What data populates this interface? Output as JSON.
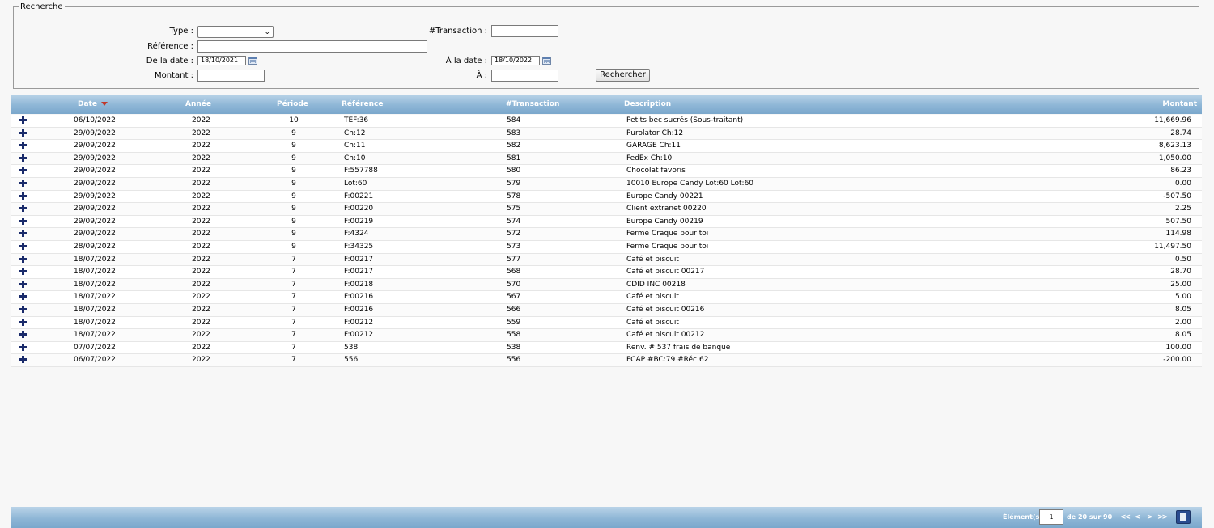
{
  "search": {
    "legend": "Recherche",
    "type_label": "Type :",
    "type_value": "",
    "reference_label": "Référence :",
    "reference_value": "",
    "from_date_label": "De la date :",
    "from_date_value": "18/10/2021",
    "amount_label": "Montant :",
    "amount_value": "",
    "transaction_label": "#Transaction :",
    "transaction_value": "",
    "to_date_label": "À la date :",
    "to_date_value": "18/10/2022",
    "to_amount_label": "À :",
    "to_amount_value": "",
    "search_button": "Rechercher"
  },
  "grid": {
    "columns": {
      "date": "Date",
      "year": "Année",
      "period": "Période",
      "reference": "Référence",
      "transaction": "#Transaction",
      "description": "Description",
      "amount": "Montant"
    },
    "rows": [
      {
        "date": "06/10/2022",
        "year": "2022",
        "period": "10",
        "reference": "TEF:36",
        "transaction": "584",
        "description": "Petits bec sucrés (Sous-traitant)",
        "amount": "11,669.96"
      },
      {
        "date": "29/09/2022",
        "year": "2022",
        "period": "9",
        "reference": "Ch:12",
        "transaction": "583",
        "description": "Purolator Ch:12",
        "amount": "28.74"
      },
      {
        "date": "29/09/2022",
        "year": "2022",
        "period": "9",
        "reference": "Ch:11",
        "transaction": "582",
        "description": "GARAGE Ch:11",
        "amount": "8,623.13"
      },
      {
        "date": "29/09/2022",
        "year": "2022",
        "period": "9",
        "reference": "Ch:10",
        "transaction": "581",
        "description": "FedEx Ch:10",
        "amount": "1,050.00"
      },
      {
        "date": "29/09/2022",
        "year": "2022",
        "period": "9",
        "reference": "F:557788",
        "transaction": "580",
        "description": "Chocolat favoris",
        "amount": "86.23"
      },
      {
        "date": "29/09/2022",
        "year": "2022",
        "period": "9",
        "reference": "Lot:60",
        "transaction": "579",
        "description": "10010 Europe Candy Lot:60 Lot:60",
        "amount": "0.00"
      },
      {
        "date": "29/09/2022",
        "year": "2022",
        "period": "9",
        "reference": "F:00221",
        "transaction": "578",
        "description": "Europe Candy 00221",
        "amount": "-507.50"
      },
      {
        "date": "29/09/2022",
        "year": "2022",
        "period": "9",
        "reference": "F:00220",
        "transaction": "575",
        "description": "Client extranet 00220",
        "amount": "2.25"
      },
      {
        "date": "29/09/2022",
        "year": "2022",
        "period": "9",
        "reference": "F:00219",
        "transaction": "574",
        "description": "Europe Candy 00219",
        "amount": "507.50"
      },
      {
        "date": "29/09/2022",
        "year": "2022",
        "period": "9",
        "reference": "F:4324",
        "transaction": "572",
        "description": "Ferme Craque pour toi",
        "amount": "114.98"
      },
      {
        "date": "28/09/2022",
        "year": "2022",
        "period": "9",
        "reference": "F:34325",
        "transaction": "573",
        "description": "Ferme Craque pour toi",
        "amount": "11,497.50"
      },
      {
        "date": "18/07/2022",
        "year": "2022",
        "period": "7",
        "reference": "F:00217",
        "transaction": "577",
        "description": "Café et biscuit",
        "amount": "0.50"
      },
      {
        "date": "18/07/2022",
        "year": "2022",
        "period": "7",
        "reference": "F:00217",
        "transaction": "568",
        "description": "Café et biscuit 00217",
        "amount": "28.70"
      },
      {
        "date": "18/07/2022",
        "year": "2022",
        "period": "7",
        "reference": "F:00218",
        "transaction": "570",
        "description": "CDID INC 00218",
        "amount": "25.00"
      },
      {
        "date": "18/07/2022",
        "year": "2022",
        "period": "7",
        "reference": "F:00216",
        "transaction": "567",
        "description": "Café et biscuit",
        "amount": "5.00"
      },
      {
        "date": "18/07/2022",
        "year": "2022",
        "period": "7",
        "reference": "F:00216",
        "transaction": "566",
        "description": "Café et biscuit 00216",
        "amount": "8.05"
      },
      {
        "date": "18/07/2022",
        "year": "2022",
        "period": "7",
        "reference": "F:00212",
        "transaction": "559",
        "description": "Café et biscuit",
        "amount": "2.00"
      },
      {
        "date": "18/07/2022",
        "year": "2022",
        "period": "7",
        "reference": "F:00212",
        "transaction": "558",
        "description": "Café et biscuit 00212",
        "amount": "8.05"
      },
      {
        "date": "07/07/2022",
        "year": "2022",
        "period": "7",
        "reference": "538",
        "transaction": "538",
        "description": "Renv. # 537 frais de banque",
        "amount": "100.00"
      },
      {
        "date": "06/07/2022",
        "year": "2022",
        "period": "7",
        "reference": "556",
        "transaction": "556",
        "description": "FCAP #BC:79 #Réc:62",
        "amount": "-200.00"
      }
    ]
  },
  "footer": {
    "elements_label": "Élément(s)",
    "page_value": "1",
    "of_text": "de 20 sur 90",
    "first_icon": "first-page-icon",
    "prev_icon": "prev-page-icon",
    "next_icon": "next-page-icon",
    "last_icon": "last-page-icon",
    "export_icon": "export-icon"
  },
  "colors": {
    "header_gradient_top": "#b9d3e8",
    "header_gradient_bottom": "#7aa7cc",
    "plus_icon": "#1a2b6b",
    "sort_arrow": "#c0392b"
  }
}
